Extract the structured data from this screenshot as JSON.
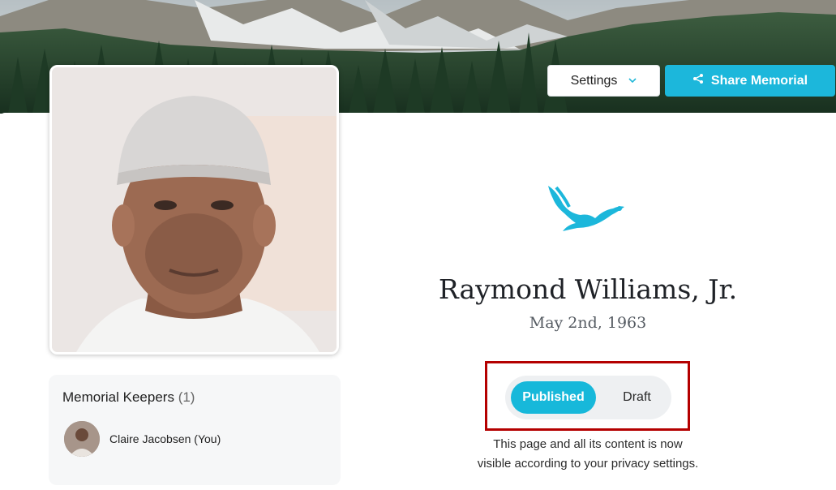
{
  "header": {
    "settings_label": "Settings",
    "share_label": "Share Memorial",
    "settings_icon": "chevron-down-icon",
    "share_icon": "share-icon"
  },
  "profile": {
    "name": "Raymond Williams, Jr.",
    "birth_date": "May 2nd, 1963",
    "emblem": "eagle-icon"
  },
  "publish_toggle": {
    "published_label": "Published",
    "draft_label": "Draft",
    "selected": "Published",
    "status_line1": "This page and all its content is now",
    "status_line2": "visible according to your privacy settings."
  },
  "keepers": {
    "title": "Memorial Keepers",
    "count": "(1)",
    "items": [
      {
        "name": "Claire Jacobsen (You)"
      }
    ]
  },
  "colors": {
    "accent": "#1cb7db",
    "highlight_border": "#b40000"
  }
}
